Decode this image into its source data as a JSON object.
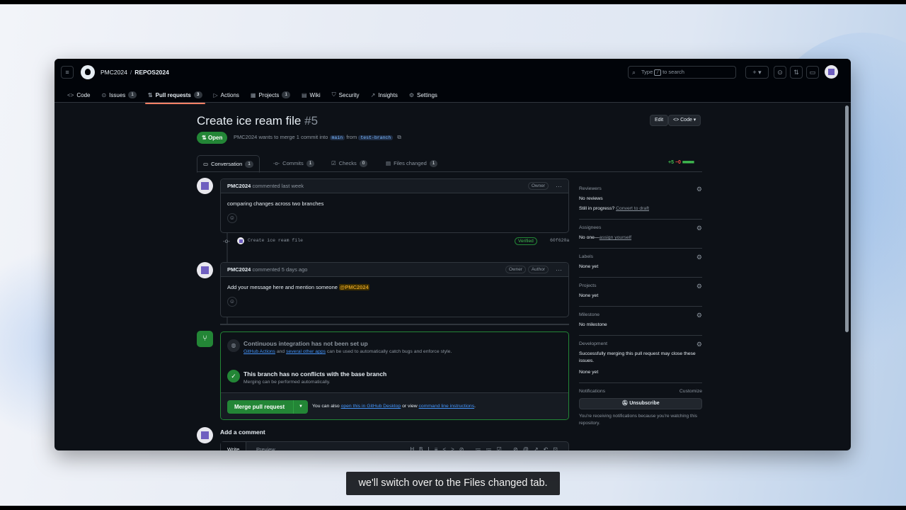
{
  "header": {
    "owner": "PMC2024",
    "separator": "/",
    "repo": "REPOS2024",
    "search_prefix": "Type",
    "search_key": "/",
    "search_suffix": "to search"
  },
  "repo_tabs": [
    {
      "label": "Code",
      "icon": "code-icon",
      "count": ""
    },
    {
      "label": "Issues",
      "icon": "issue-icon",
      "count": "1"
    },
    {
      "label": "Pull requests",
      "icon": "pull-request-icon",
      "count": "3"
    },
    {
      "label": "Actions",
      "icon": "play-icon",
      "count": ""
    },
    {
      "label": "Projects",
      "icon": "table-icon",
      "count": "1"
    },
    {
      "label": "Wiki",
      "icon": "book-icon",
      "count": ""
    },
    {
      "label": "Security",
      "icon": "shield-icon",
      "count": ""
    },
    {
      "label": "Insights",
      "icon": "graph-icon",
      "count": ""
    },
    {
      "label": "Settings",
      "icon": "gear-icon",
      "count": ""
    }
  ],
  "pr": {
    "title": "Create ice ream file",
    "number": "#5",
    "edit_label": "Edit",
    "code_label": "Code",
    "state": "Open",
    "meta_author": "PMC2024",
    "meta_text": "wants to merge 1 commit into",
    "base_branch": "main",
    "meta_from": "from",
    "head_branch": "test-branch"
  },
  "pr_tabs": [
    {
      "label": "Conversation",
      "count": "1"
    },
    {
      "label": "Commits",
      "count": "1"
    },
    {
      "label": "Checks",
      "count": "0"
    },
    {
      "label": "Files changed",
      "count": "1"
    }
  ],
  "diffstat": {
    "add": "+5",
    "del": "−0",
    "blocks": "■■■■■"
  },
  "comments": [
    {
      "author": "PMC2024",
      "time": "commented last week",
      "roles": [
        "Owner"
      ],
      "body": "comparing changes across two branches"
    },
    {
      "author": "PMC2024",
      "time": "commented 5 days ago",
      "roles": [
        "Owner",
        "Author"
      ],
      "body": "Add your message here and mention someone",
      "mention": "@PMC2024"
    }
  ],
  "commit": {
    "message": "Create ice ream file",
    "verified": "Verified",
    "sha": "60f620a"
  },
  "merge": {
    "ci_title": "Continuous integration has not been set up",
    "ci_link1": "GitHub Actions",
    "ci_and": "and",
    "ci_link2": "several other apps",
    "ci_rest": "can be used to automatically catch bugs and enforce style.",
    "ok_title": "This branch has no conflicts with the base branch",
    "ok_sub": "Merging can be performed automatically.",
    "button": "Merge pull request",
    "alt_prefix": "You can also",
    "alt_link1": "open this in GitHub Desktop",
    "alt_mid": "or view",
    "alt_link2": "command line instructions",
    "alt_end": "."
  },
  "add_comment": {
    "title": "Add a comment",
    "write": "Write",
    "preview": "Preview"
  },
  "sidebar": {
    "reviewers": {
      "title": "Reviewers",
      "value": "No reviews",
      "progress": "Still in progress?",
      "convert": "Convert to draft"
    },
    "assignees": {
      "title": "Assignees",
      "value": "No one—",
      "assign": "assign yourself"
    },
    "labels": {
      "title": "Labels",
      "value": "None yet"
    },
    "projects": {
      "title": "Projects",
      "value": "None yet"
    },
    "milestone": {
      "title": "Milestone",
      "value": "No milestone"
    },
    "development": {
      "title": "Development",
      "desc": "Successfully merging this pull request may close these issues.",
      "value": "None yet"
    },
    "notifications": {
      "title": "Notifications",
      "customize": "Customize",
      "button": "Unsubscribe",
      "info": "You're receiving notifications because you're watching this repository."
    }
  },
  "caption": "we'll switch over to the Files changed tab."
}
